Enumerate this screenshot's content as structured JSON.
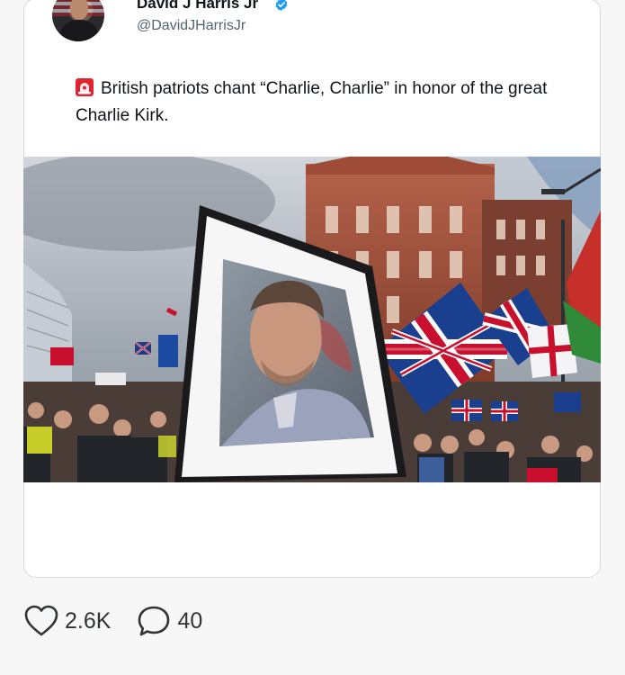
{
  "post": {
    "author_name": "David J Harris Jr",
    "author_handle": "@DavidJHarrisJr",
    "verified": true,
    "text": "British patriots chant “Charlie, Charlie” in honor of the great Charlie Kirk.",
    "leading_emoji": "siren-icon",
    "media": {
      "type": "video-thumbnail"
    }
  },
  "engagement": {
    "likes": "2.6K",
    "replies": "40"
  },
  "colors": {
    "verified_blue": "#1d9bf0",
    "text": "#0f1419",
    "secondary_text": "#536471",
    "union_red": "#c8102e",
    "union_blue": "#012169"
  }
}
